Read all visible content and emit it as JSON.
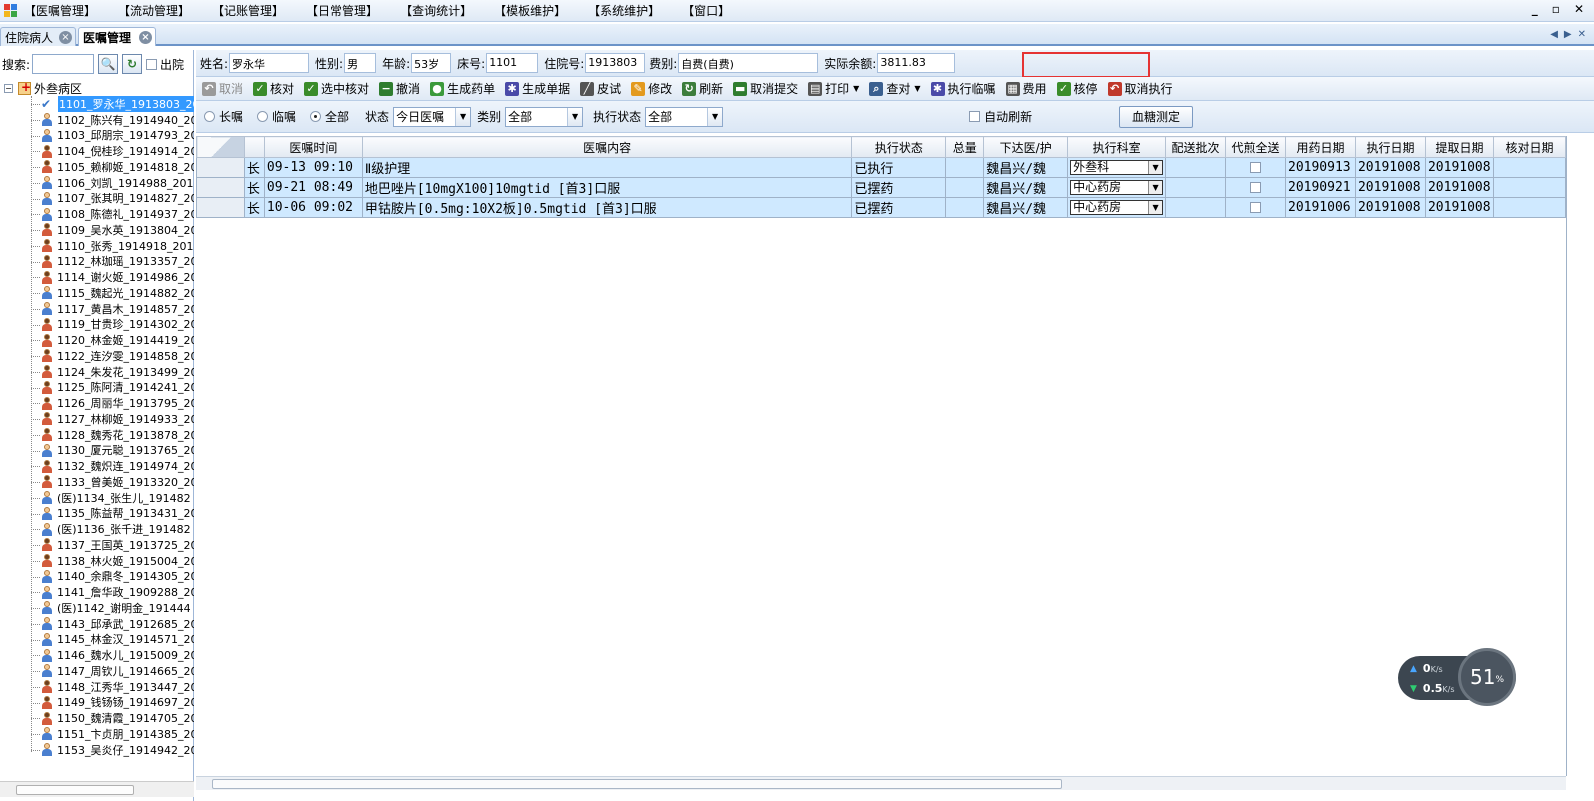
{
  "menu": [
    "【医嘱管理】",
    "【流动管理】",
    "【记账管理】",
    "【日常管理】",
    "【查询统计】",
    "【模板维护】",
    "【系统维护】",
    "【窗口】"
  ],
  "window_controls": [
    "_",
    "▫",
    "✕"
  ],
  "tabs": [
    {
      "label": "住院病人",
      "active": false
    },
    {
      "label": "医嘱管理",
      "active": true
    }
  ],
  "left": {
    "search_label": "搜索:",
    "search_value": "",
    "leave_label": "出院",
    "ward": "外叁病区",
    "patients": [
      {
        "label": "1101_罗永华_1913803_20",
        "sex": "check",
        "selected": true
      },
      {
        "label": "1102_陈兴有_1914940_20",
        "sex": "male"
      },
      {
        "label": "1103_邱朋宗_1914793_20",
        "sex": "male"
      },
      {
        "label": "1104_倪桂珍_1914914_20",
        "sex": "female"
      },
      {
        "label": "1105_赖柳姬_1914818_20",
        "sex": "female"
      },
      {
        "label": "1106_刘凯_1914988_2019",
        "sex": "male"
      },
      {
        "label": "1107_张其明_1914827_20",
        "sex": "male"
      },
      {
        "label": "1108_陈德礼_1914937_20",
        "sex": "male"
      },
      {
        "label": "1109_吴水英_1913804_20",
        "sex": "female"
      },
      {
        "label": "1110_张秀_1914918_2019",
        "sex": "female"
      },
      {
        "label": "1112_林珈瑶_1913357_20",
        "sex": "female"
      },
      {
        "label": "1114_谢火姬_1914986_20",
        "sex": "female"
      },
      {
        "label": "1115_魏起光_1914882_20",
        "sex": "male"
      },
      {
        "label": "1117_黄昌木_1914857_20",
        "sex": "male"
      },
      {
        "label": "1119_甘贵珍_1914302_20",
        "sex": "female"
      },
      {
        "label": "1120_林金姬_1914419_20",
        "sex": "female"
      },
      {
        "label": "1122_连汐雯_1914858_20",
        "sex": "female"
      },
      {
        "label": "1124_朱发花_1913499_20",
        "sex": "female"
      },
      {
        "label": "1125_陈阿清_1914241_20",
        "sex": "female"
      },
      {
        "label": "1126_周丽华_1913795_20",
        "sex": "female"
      },
      {
        "label": "1127_林柳姬_1914933_20",
        "sex": "female"
      },
      {
        "label": "1128_魏秀花_1913878_20",
        "sex": "female"
      },
      {
        "label": "1130_厦元聪_1913765_20",
        "sex": "male"
      },
      {
        "label": "1132_魏炽连_1914974_20",
        "sex": "female"
      },
      {
        "label": "1133_曾美姬_1913320_20",
        "sex": "female"
      },
      {
        "label": "(医)1134_张生儿_191482",
        "sex": "male"
      },
      {
        "label": "1135_陈益帮_1913431_20",
        "sex": "male"
      },
      {
        "label": "(医)1136_张千进_191482",
        "sex": "male"
      },
      {
        "label": "1137_王国英_1913725_20",
        "sex": "female"
      },
      {
        "label": "1138_林火姬_1915004_20",
        "sex": "female"
      },
      {
        "label": "1140_余鼎冬_1914305_20",
        "sex": "male"
      },
      {
        "label": "1141_詹华政_1909288_20",
        "sex": "male"
      },
      {
        "label": "(医)1142_谢明金_191444",
        "sex": "male"
      },
      {
        "label": "1143_邱承武_1912685_20",
        "sex": "male"
      },
      {
        "label": "1145_林金汉_1914571_20",
        "sex": "male"
      },
      {
        "label": "1146_魏水儿_1915009_20",
        "sex": "male"
      },
      {
        "label": "1147_周钦儿_1914665_20",
        "sex": "male"
      },
      {
        "label": "1148_江秀华_1913447_20",
        "sex": "female"
      },
      {
        "label": "1149_钱钖钖_1914697_20",
        "sex": "female"
      },
      {
        "label": "1150_魏清霞_1914705_20",
        "sex": "female"
      },
      {
        "label": "1151_卞贞朋_1914385_20",
        "sex": "male"
      },
      {
        "label": "1153_吴炎仔_1914942_20",
        "sex": "male"
      }
    ]
  },
  "info": {
    "name_label": "姓名:",
    "name": "罗永华",
    "sex_label": "性别:",
    "sex": "男",
    "age_label": "年龄:",
    "age": "53岁",
    "bed_label": "床号:",
    "bed": "1101",
    "inpatient_label": "住院号:",
    "inpatient": "1913803",
    "fee_label": "费别:",
    "fee": "自费(自费)",
    "balance_label": "实际余额:",
    "balance": "3811.83"
  },
  "toolbar": [
    {
      "label": "取消",
      "icon": "undo-icon",
      "color": "#9a9a9a",
      "disabled": true
    },
    {
      "label": "核对",
      "icon": "check-icon",
      "color": "#3a8c2a"
    },
    {
      "label": "选中核对",
      "icon": "check-icon",
      "color": "#3a8c2a"
    },
    {
      "label": "撤消",
      "icon": "minus-circle-icon",
      "color": "#2f7d2f"
    },
    {
      "label": "生成药单",
      "icon": "pills-icon",
      "color": "#3b9a3b"
    },
    {
      "label": "生成单据",
      "icon": "gear-icon",
      "color": "#4a4aa8"
    },
    {
      "label": "皮试",
      "icon": "syringe-icon",
      "color": "#555555"
    },
    {
      "label": "修改",
      "icon": "edit-icon",
      "color": "#e39a1f"
    },
    {
      "label": "刷新",
      "icon": "refresh-icon",
      "color": "#3c7d3c"
    },
    {
      "label": "取消提交",
      "icon": "cancel-submit-icon",
      "color": "#2f7d2f"
    },
    {
      "label": "打印",
      "icon": "printer-icon",
      "color": "#555555",
      "dropdown": true
    },
    {
      "label": "查对",
      "icon": "magnifier-icon",
      "color": "#3a5f8f",
      "dropdown": true
    },
    {
      "label": "执行临嘱",
      "icon": "gear-icon",
      "color": "#4a4aa8"
    },
    {
      "label": "费用",
      "icon": "calculator-icon",
      "color": "#555555"
    },
    {
      "label": "核停",
      "icon": "check-icon",
      "color": "#3a8c2a"
    },
    {
      "label": "取消执行",
      "icon": "undo-icon",
      "color": "#c0392b"
    }
  ],
  "filters": {
    "radio_long": "长嘱",
    "radio_temp": "临嘱",
    "radio_all": "全部",
    "status_label": "状态",
    "status_value": "今日医嘱",
    "category_label": "类别",
    "category_value": "全部",
    "exec_label": "执行状态",
    "exec_value": "全部",
    "auto_refresh": "自动刷新",
    "glucose_button": "血糖测定"
  },
  "grid": {
    "columns": [
      "",
      "",
      "医嘱时间",
      "医嘱内容",
      "执行状态",
      "总量",
      "下达医/护",
      "执行科室",
      "配送批次",
      "代煎全送",
      "用药日期",
      "执行日期",
      "提取日期",
      "核对日期"
    ],
    "rows": [
      [
        "长",
        "09-13 09:10",
        "Ⅱ级护理",
        "已执行",
        "",
        "魏昌兴/魏",
        "外叁科",
        "",
        "",
        "20190913",
        "20191008",
        "20191008",
        ""
      ],
      [
        "长",
        "09-21 08:49",
        "地巴唑片[10mgX100]10mgtid [首3]口服",
        "已摆药",
        "",
        "魏昌兴/魏",
        "中心药房",
        "",
        "",
        "20190921",
        "20191008",
        "20191008",
        ""
      ],
      [
        "长",
        "10-06 09:02",
        "甲钴胺片[0.5mg:10X2板]0.5mgtid [首3]口服",
        "已摆药",
        "",
        "魏昌兴/魏",
        "中心药房",
        "",
        "",
        "20191006",
        "20191008",
        "20191008",
        ""
      ]
    ]
  },
  "network": {
    "up": "0",
    "up_unit": "K/s",
    "down": "0.5",
    "down_unit": "K/s",
    "percent": "51",
    "percent_unit": "%"
  },
  "colors": {
    "row_bg": "#cfe9ff",
    "selected": "#3399ff",
    "highlight_box": "#e53333"
  }
}
